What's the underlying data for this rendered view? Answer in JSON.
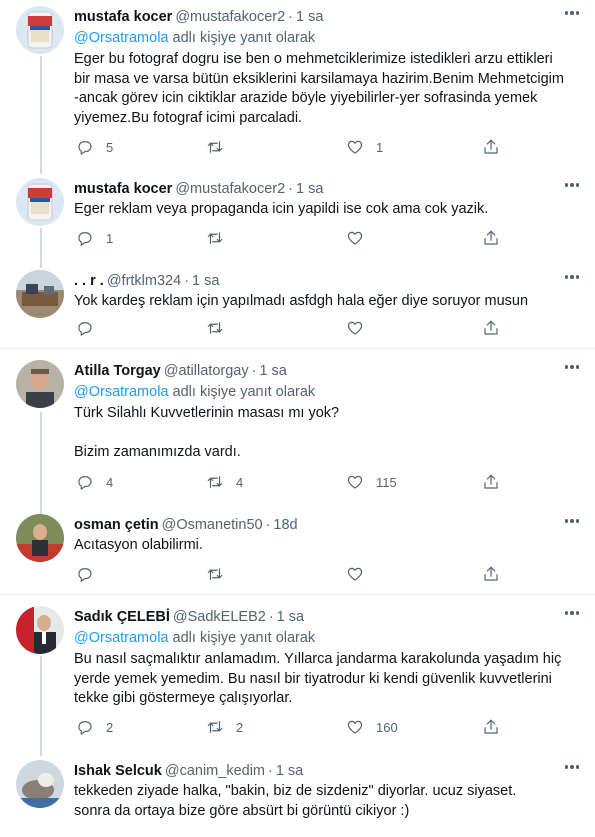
{
  "reply_prefix_suffix": "adlı kişiye yanıt olarak",
  "tweets": [
    {
      "name": "mustafa kocer",
      "handle": "@mustafakocer2",
      "time": "1 sa",
      "reply_to": "@Orsatramola",
      "lines": [
        "Eger bu fotograf dogru ise ben o mehmetciklerimize istedikleri arzu ettikleri",
        "bir masa ve varsa bütün eksiklerini karsilamaya hazirim.Benim Mehmetcigim",
        "-ancak görev icin ciktiklar arazide böyle yiyebilirler-yer sofrasinda yemek",
        "yiyemez.Bu fotograf icimi parcaladi."
      ],
      "replies": "5",
      "retweets": "",
      "likes": "1"
    },
    {
      "name": "mustafa kocer",
      "handle": "@mustafakocer2",
      "time": "1 sa",
      "lines": [
        "Eger reklam veya propaganda icin yapildi ise cok ama cok yazik."
      ],
      "replies": "1",
      "retweets": "",
      "likes": ""
    },
    {
      "name": ". . r .",
      "handle": "@frtklm324",
      "time": "1 sa",
      "lines": [
        "Yok kardeş reklam için yapılmadı asfdgh hala eğer diye soruyor musun"
      ],
      "replies": "",
      "retweets": "",
      "likes": ""
    },
    {
      "name": "Atilla Torgay",
      "handle": "@atillatorgay",
      "time": "1 sa",
      "reply_to": "@Orsatramola",
      "lines": [
        "Türk Silahlı Kuvvetlerinin masası mı yok?",
        "",
        "Bizim zamanımızda vardı."
      ],
      "replies": "4",
      "retweets": "4",
      "likes": "115"
    },
    {
      "name": "osman çetin",
      "handle": "@Osmanetin50",
      "time": "18d",
      "lines": [
        "Acıtasyon olabilirmi."
      ],
      "replies": "",
      "retweets": "",
      "likes": ""
    },
    {
      "name": "Sadık ÇELEBİ",
      "handle": "@SadkELEB2",
      "time": "1 sa",
      "reply_to": "@Orsatramola",
      "lines": [
        "Bu nasıl saçmalıktır anlamadım. Yıllarca jandarma karakolunda yaşadım hiç",
        "yerde yemek yemedim. Bu nasıl bir tiyatrodur ki kendi güvenlik kuvvetlerini",
        "tekke gibi göstermeye çalışıyorlar."
      ],
      "replies": "2",
      "retweets": "2",
      "likes": "160"
    },
    {
      "name": "Ishak Selcuk",
      "handle": "@canim_kedim",
      "time": "1 sa",
      "lines": [
        "tekkeden ziyade halka, \"bakin, biz de sizdeniz\" diyorlar. ucuz siyaset.",
        "sonra da ortaya bize göre absürt bi görüntü cikiyor :)"
      ],
      "replies": "",
      "retweets": "",
      "likes": ""
    }
  ],
  "icons": {
    "reply": "reply-icon",
    "retweet": "retweet-icon",
    "like": "heart-icon",
    "share": "share-icon",
    "more": "more-icon"
  },
  "colors": {
    "link": "#1d9bf0",
    "secondary_text": "#536471",
    "thread_line": "#cfd9de"
  }
}
